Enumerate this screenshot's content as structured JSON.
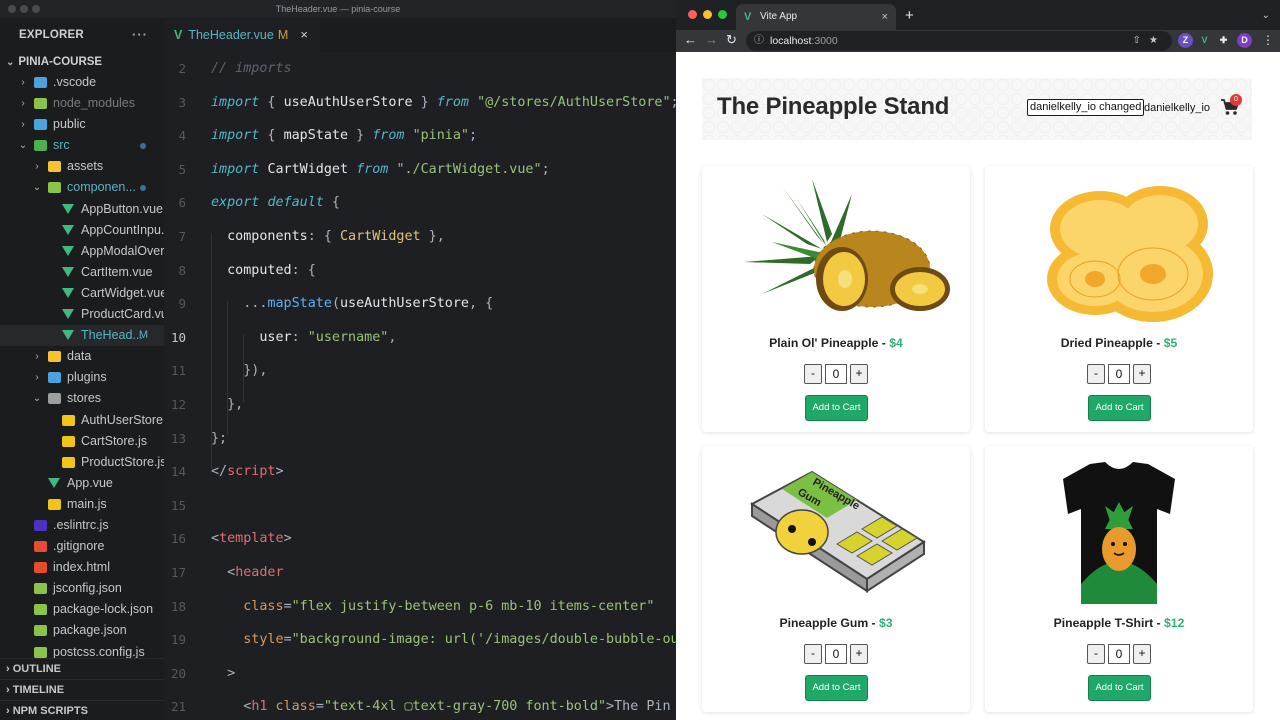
{
  "vscode": {
    "window_title": "TheHeader.vue — pinia-course",
    "explorer_title": "EXPLORER",
    "explorer_more": "···",
    "project_name": "PINIA-COURSE",
    "tree": [
      {
        "label": ".vscode",
        "kind": "folder",
        "chev": "›",
        "color": "#4aa3df"
      },
      {
        "label": "node_modules",
        "kind": "folder",
        "chev": "›",
        "color": "#8bc34a"
      },
      {
        "label": "public",
        "kind": "folder",
        "chev": "›",
        "color": "#4aa3df"
      },
      {
        "label": "src",
        "kind": "folder-open",
        "chev": "⌄",
        "color": "#4caf50"
      },
      {
        "label": "assets",
        "kind": "folder",
        "chev": "›",
        "color": "#f4c430"
      },
      {
        "label": "componen...",
        "kind": "folder-open",
        "chev": "⌄",
        "color": "#8bc34a"
      },
      {
        "label": "AppButton.vue",
        "kind": "vue"
      },
      {
        "label": "AppCountInpu...",
        "kind": "vue"
      },
      {
        "label": "AppModalOver...",
        "kind": "vue"
      },
      {
        "label": "CartItem.vue",
        "kind": "vue"
      },
      {
        "label": "CartWidget.vue",
        "kind": "vue"
      },
      {
        "label": "ProductCard.vue",
        "kind": "vue"
      },
      {
        "label": "TheHead...",
        "kind": "vue",
        "git": "M"
      },
      {
        "label": "data",
        "kind": "folder",
        "chev": "›",
        "color": "#f4c430"
      },
      {
        "label": "plugins",
        "kind": "folder",
        "chev": "›",
        "color": "#4aa3df"
      },
      {
        "label": "stores",
        "kind": "folder-open",
        "chev": "⌄",
        "color": "#9e9e9e"
      },
      {
        "label": "AuthUserStore...",
        "kind": "js"
      },
      {
        "label": "CartStore.js",
        "kind": "js"
      },
      {
        "label": "ProductStore.js",
        "kind": "js"
      },
      {
        "label": "App.vue",
        "kind": "vue"
      },
      {
        "label": "main.js",
        "kind": "js"
      },
      {
        "label": ".eslintrc.js",
        "kind": "eslint"
      },
      {
        "label": ".gitignore",
        "kind": "git"
      },
      {
        "label": "index.html",
        "kind": "html"
      },
      {
        "label": "jsconfig.json",
        "kind": "json"
      },
      {
        "label": "package-lock.json",
        "kind": "json"
      },
      {
        "label": "package.json",
        "kind": "json"
      },
      {
        "label": "postcss.config.js",
        "kind": "json"
      }
    ],
    "sections": [
      "OUTLINE",
      "TIMELINE",
      "NPM SCRIPTS"
    ],
    "tab": {
      "label": "TheHeader.vue",
      "modified": "M",
      "close": "×"
    },
    "code": [
      {
        "n": "2",
        "tokens": [
          [
            "cmt",
            "// imports"
          ]
        ]
      },
      {
        "n": "3",
        "tokens": [
          [
            "kw2",
            "import"
          ],
          [
            "punc",
            " { "
          ],
          [
            "prop",
            "useAuthUserStore"
          ],
          [
            "punc",
            " } "
          ],
          [
            "kw2",
            "from"
          ],
          [
            "punc",
            " "
          ],
          [
            "str",
            "\"@/stores/AuthUserStore\""
          ],
          [
            "punc",
            ";"
          ]
        ]
      },
      {
        "n": "4",
        "tokens": [
          [
            "kw2",
            "import"
          ],
          [
            "punc",
            " { "
          ],
          [
            "prop",
            "mapState"
          ],
          [
            "punc",
            " } "
          ],
          [
            "kw2",
            "from"
          ],
          [
            "punc",
            " "
          ],
          [
            "str",
            "\"pinia\""
          ],
          [
            "punc",
            ";"
          ]
        ]
      },
      {
        "n": "5",
        "tokens": [
          [
            "kw2",
            "import"
          ],
          [
            "punc",
            " "
          ],
          [
            "prop",
            "CartWidget"
          ],
          [
            "punc",
            " "
          ],
          [
            "kw2",
            "from"
          ],
          [
            "punc",
            " "
          ],
          [
            "str",
            "\"./CartWidget.vue\""
          ],
          [
            "punc",
            ";"
          ]
        ]
      },
      {
        "n": "6",
        "tokens": [
          [
            "kw2",
            "export"
          ],
          [
            "punc",
            " "
          ],
          [
            "kw2",
            "default"
          ],
          [
            "punc",
            " {"
          ]
        ]
      },
      {
        "n": "7",
        "tokens": [
          [
            "punc",
            "  "
          ],
          [
            "prop",
            "components"
          ],
          [
            "punc",
            ": { "
          ],
          [
            "cls",
            "CartWidget"
          ],
          [
            "punc",
            " },"
          ]
        ]
      },
      {
        "n": "8",
        "tokens": [
          [
            "punc",
            "  "
          ],
          [
            "prop",
            "computed"
          ],
          [
            "punc",
            ": {"
          ]
        ]
      },
      {
        "n": "9",
        "tokens": [
          [
            "punc",
            "    ..."
          ],
          [
            "fn",
            "mapState"
          ],
          [
            "punc",
            "("
          ],
          [
            "prop",
            "useAuthUserStore"
          ],
          [
            "punc",
            ", {"
          ]
        ]
      },
      {
        "n": "10",
        "tokens": [
          [
            "punc",
            "      "
          ],
          [
            "prop",
            "user"
          ],
          [
            "punc",
            ": "
          ],
          [
            "str",
            "\"username\""
          ],
          [
            "punc",
            ","
          ]
        ]
      },
      {
        "n": "11",
        "tokens": [
          [
            "punc",
            "    }),"
          ]
        ]
      },
      {
        "n": "12",
        "tokens": [
          [
            "punc",
            "  },"
          ]
        ]
      },
      {
        "n": "13",
        "tokens": [
          [
            "punc",
            "};"
          ]
        ]
      },
      {
        "n": "14",
        "tokens": [
          [
            "punc",
            "</"
          ],
          [
            "tag",
            "script"
          ],
          [
            "punc",
            ">"
          ]
        ]
      },
      {
        "n": "15",
        "tokens": []
      },
      {
        "n": "16",
        "tokens": [
          [
            "punc",
            "<"
          ],
          [
            "tag",
            "template"
          ],
          [
            "punc",
            ">"
          ]
        ]
      },
      {
        "n": "17",
        "tokens": [
          [
            "punc",
            "  <"
          ],
          [
            "tag",
            "header"
          ]
        ]
      },
      {
        "n": "18",
        "tokens": [
          [
            "punc",
            "    "
          ],
          [
            "attr",
            "class"
          ],
          [
            "punc",
            "="
          ],
          [
            "str",
            "\"flex justify-between p-6 mb-10 items-center\""
          ]
        ]
      },
      {
        "n": "19",
        "tokens": [
          [
            "punc",
            "    "
          ],
          [
            "attr",
            "style"
          ],
          [
            "punc",
            "="
          ],
          [
            "str",
            "\"background-image: url('/images/double-bubble-ou"
          ]
        ]
      },
      {
        "n": "20",
        "tokens": [
          [
            "punc",
            "  >"
          ]
        ]
      },
      {
        "n": "21",
        "tokens": [
          [
            "punc",
            "    <"
          ],
          [
            "tag",
            "h1"
          ],
          [
            "punc",
            " "
          ],
          [
            "attr",
            "class"
          ],
          [
            "punc",
            "="
          ],
          [
            "str",
            "\"text-4xl ▢text-gray-700 font-bold\""
          ],
          [
            "punc",
            ">The Pin"
          ]
        ]
      }
    ],
    "current_line": "10"
  },
  "chrome": {
    "tab_title": "Vite App",
    "tab_close": "×",
    "new_tab": "+",
    "tab_menu": "⌄",
    "url_host": "localhost",
    "url_port": ":3000",
    "profile_initial": "D",
    "ext_icons": [
      "Z",
      "V",
      "✚"
    ],
    "omnibox_icons": "⇧★"
  },
  "site": {
    "title": "The Pineapple Stand",
    "username_input_value": "danielkelly_io changed",
    "username_display": "danielkelly_io",
    "cart_count": "0",
    "products": [
      {
        "name": "Plain Ol' Pineapple",
        "price": "$4",
        "qty": "0",
        "image": "pineapple"
      },
      {
        "name": "Dried Pineapple",
        "price": "$5",
        "qty": "0",
        "image": "dried-pineapple"
      },
      {
        "name": "Pineapple Gum",
        "price": "$3",
        "qty": "0",
        "image": "gum"
      },
      {
        "name": "Pineapple T-Shirt",
        "price": "$12",
        "qty": "0",
        "image": "tshirt"
      }
    ],
    "minus_label": "-",
    "plus_label": "+",
    "add_to_cart_label": "Add to Cart",
    "price_sep": " - ",
    "colors": {
      "price": "#2fb178",
      "add_button": "#1fa868",
      "badge": "#e53935"
    }
  }
}
